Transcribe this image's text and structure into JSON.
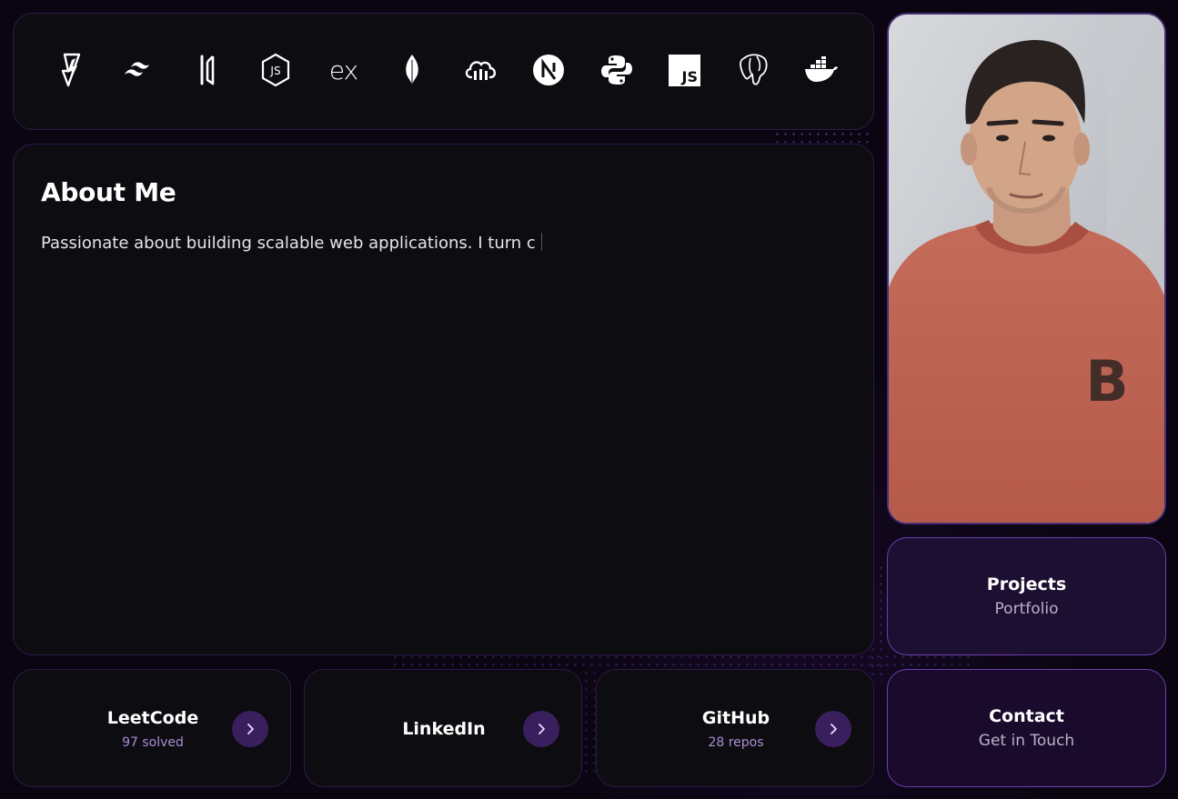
{
  "colors": {
    "background": "#0a0511",
    "card": "#0d0c10",
    "card_border": "#2e1a4a",
    "accent": "#6a3fb0",
    "arrow_bg": "#3a1f5e",
    "stat_text": "#a98fd6"
  },
  "tech_stack": {
    "icons": [
      "vite-icon",
      "tailwind-icon",
      "prisma-icon",
      "nodejs-icon",
      "express-icon",
      "mongodb-icon",
      "cloudinary-icon",
      "nextjs-icon",
      "python-icon",
      "javascript-icon",
      "postgresql-icon",
      "docker-icon"
    ],
    "express_text": "ex",
    "js_text": "JS"
  },
  "about": {
    "title": "About Me",
    "text": "Passionate about building scalable web applications. I turn c"
  },
  "profile": {
    "sweater_letter": "B"
  },
  "projects": {
    "title": "Projects",
    "subtitle": "Portfolio"
  },
  "contact": {
    "title": "Contact",
    "subtitle": "Get in Touch"
  },
  "social": {
    "leetcode": {
      "name": "LeetCode",
      "stat": "97 solved",
      "arrow": "›"
    },
    "linkedin": {
      "name": "LinkedIn",
      "arrow": "›"
    },
    "github": {
      "name": "GitHub",
      "stat": "28 repos",
      "arrow": "›"
    }
  }
}
